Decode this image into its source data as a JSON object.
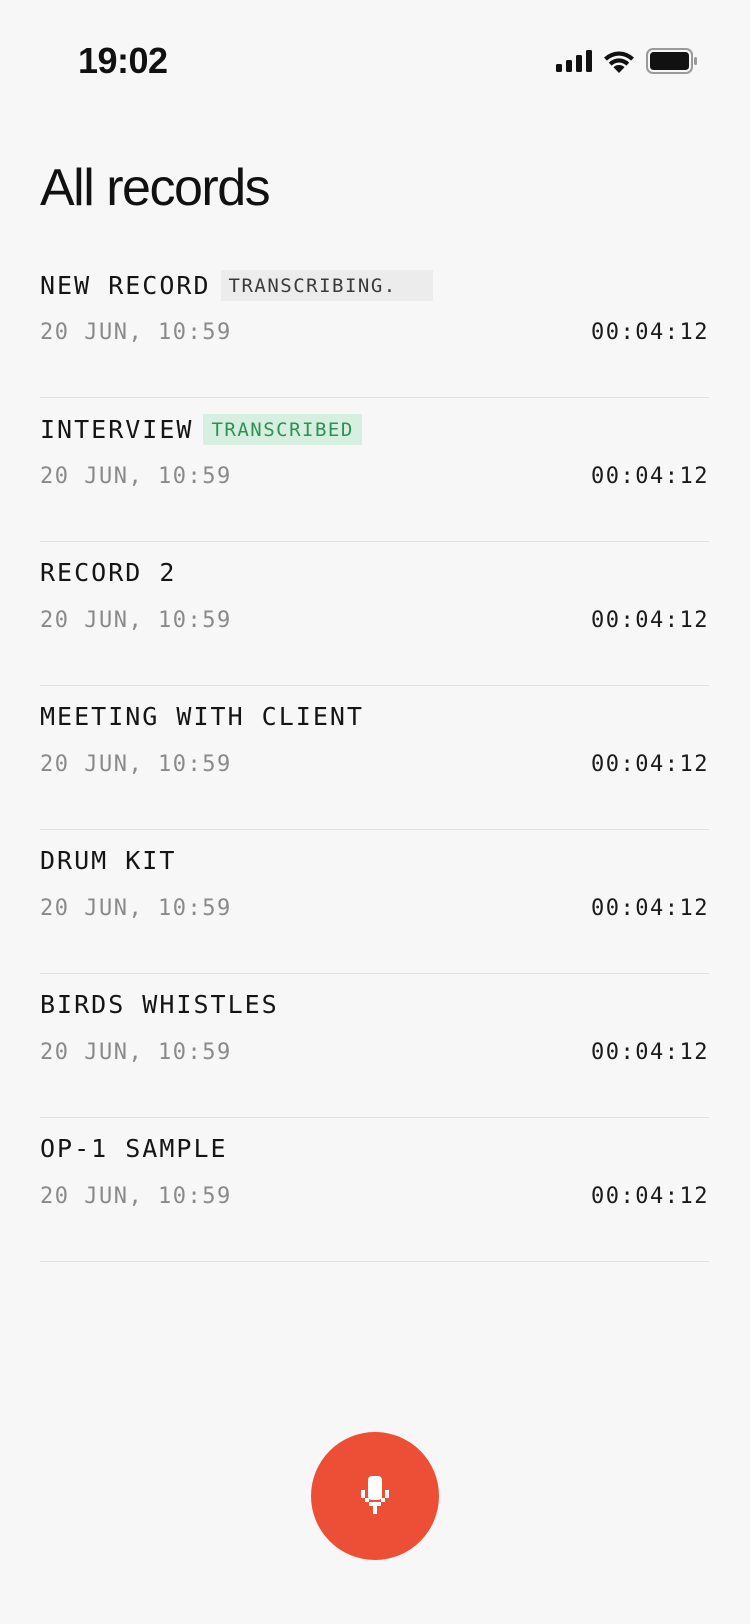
{
  "status_bar": {
    "time": "19:02",
    "icons": [
      "cellular-signal-icon",
      "wifi-icon",
      "battery-icon"
    ]
  },
  "page": {
    "title": "All records"
  },
  "records": [
    {
      "title": "NEW RECORD",
      "badge": "TRANSCRIBING.",
      "badge_status": "transcribing",
      "date": "20 JUN, 10:59",
      "duration": "00:04:12"
    },
    {
      "title": "INTERVIEW",
      "badge": "TRANSCRIBED",
      "badge_status": "transcribed",
      "date": "20 JUN, 10:59",
      "duration": "00:04:12"
    },
    {
      "title": "RECORD 2",
      "badge": "",
      "badge_status": "",
      "date": "20 JUN, 10:59",
      "duration": "00:04:12"
    },
    {
      "title": "MEETING WITH CLIENT",
      "badge": "",
      "badge_status": "",
      "date": "20 JUN, 10:59",
      "duration": "00:04:12"
    },
    {
      "title": "DRUM KIT",
      "badge": "",
      "badge_status": "",
      "date": "20 JUN, 10:59",
      "duration": "00:04:12"
    },
    {
      "title": "BIRDS WHISTLES",
      "badge": "",
      "badge_status": "",
      "date": "20 JUN, 10:59",
      "duration": "00:04:12"
    },
    {
      "title": "OP-1 SAMPLE",
      "badge": "",
      "badge_status": "",
      "date": "20 JUN, 10:59",
      "duration": "00:04:12"
    }
  ],
  "record_button": {
    "icon": "microphone-icon"
  },
  "colors": {
    "background": "#f7f7f7",
    "accent": "#ec4f35",
    "transcribed_bg": "#d7efe0",
    "transcribed_text": "#2e9153",
    "transcribing_bg": "#ececec",
    "muted_text": "#8a8a8a",
    "divider": "#e2e2e2"
  }
}
